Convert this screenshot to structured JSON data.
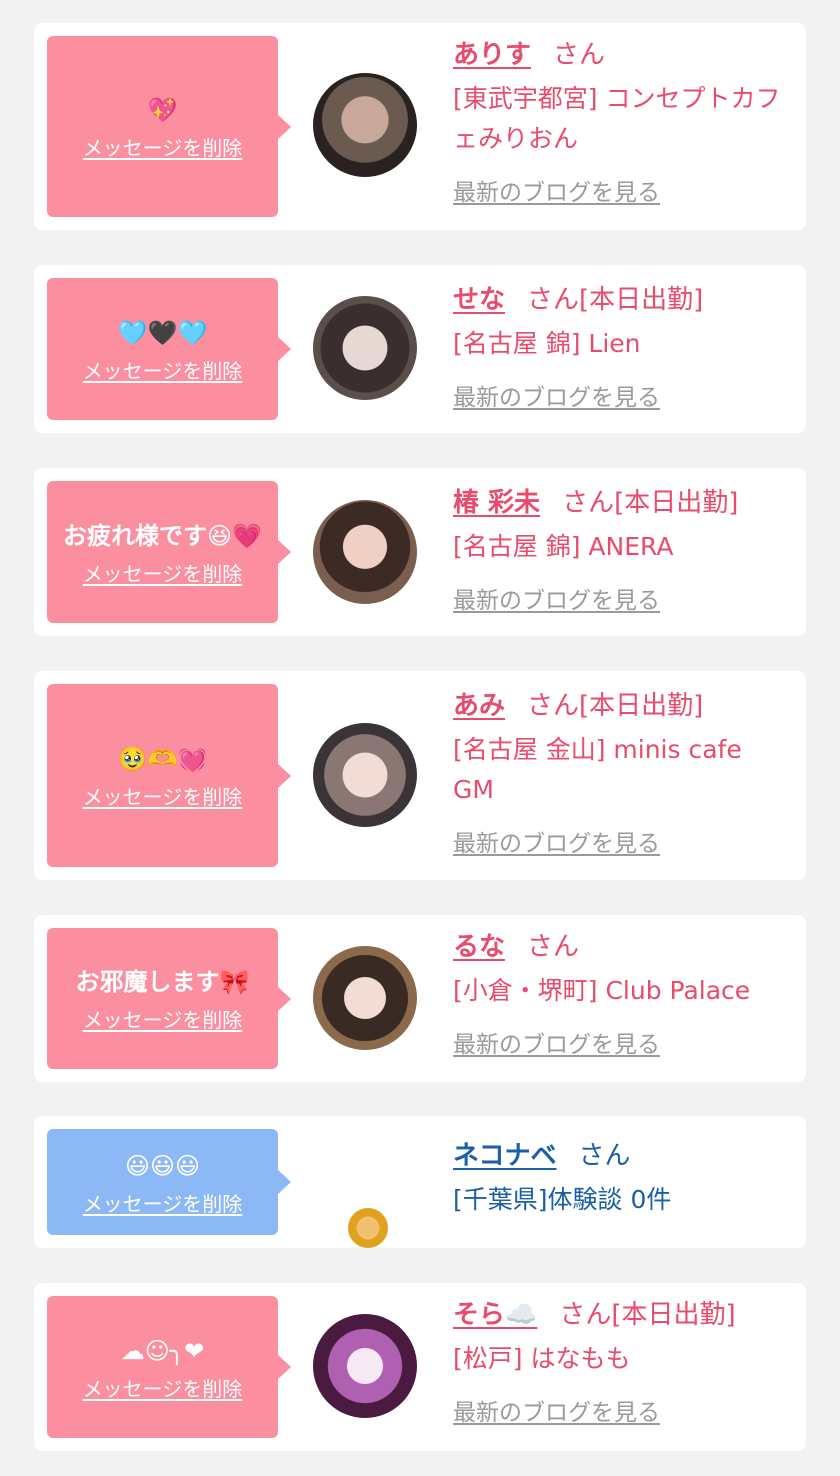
{
  "common": {
    "delete_label": "メッセージを削除",
    "blog_label": "最新のブログを見る"
  },
  "colors": {
    "bubble_pink": "#fb8fa0",
    "bubble_blue": "#8cb8f5",
    "name_pink": "#e94b6c",
    "name_blue": "#1a5fa8"
  },
  "messages": [
    {
      "message": "💖",
      "name": "ありす",
      "suffix": "さん",
      "status": "",
      "shop": "[東武宇都宮] コンセプトカフェみりおん",
      "blog": "最新のブログを見る",
      "delete": "メッセージを削除"
    },
    {
      "message": "🩵🖤🩵",
      "name": "せな",
      "suffix": "さん",
      "status": "[本日出勤]",
      "shop": "[名古屋 錦] Lien",
      "blog": "最新のブログを見る",
      "delete": "メッセージを削除"
    },
    {
      "message": "お疲れ様です😆💗",
      "name": "椿 彩未",
      "suffix": "さん",
      "status": "[本日出勤]",
      "shop": "[名古屋 錦] ANERA",
      "blog": "最新のブログを見る",
      "delete": "メッセージを削除"
    },
    {
      "message": "🥹🫶💓",
      "name": "あみ",
      "suffix": "さん",
      "status": "[本日出勤]",
      "shop": "[名古屋 金山] minis cafe GM",
      "blog": "最新のブログを見る",
      "delete": "メッセージを削除"
    },
    {
      "message": "お邪魔します🎀",
      "name": "るな",
      "suffix": "さん",
      "status": "",
      "shop": "[小倉・堺町] Club Palace",
      "blog": "最新のブログを見る",
      "delete": "メッセージを削除"
    },
    {
      "message": "😃😃😃",
      "name": "ネコナベ",
      "suffix": "さん",
      "status": "",
      "shop": "[千葉県]体験談 0件",
      "blog": "",
      "delete": "メッセージを削除"
    },
    {
      "message": "☁☺︎╮❤︎",
      "name": "そら☁️",
      "suffix": "さん",
      "status": "[本日出勤]",
      "shop": "[松戸] はなもも",
      "blog": "最新のブログを見る",
      "delete": "メッセージを削除"
    }
  ]
}
